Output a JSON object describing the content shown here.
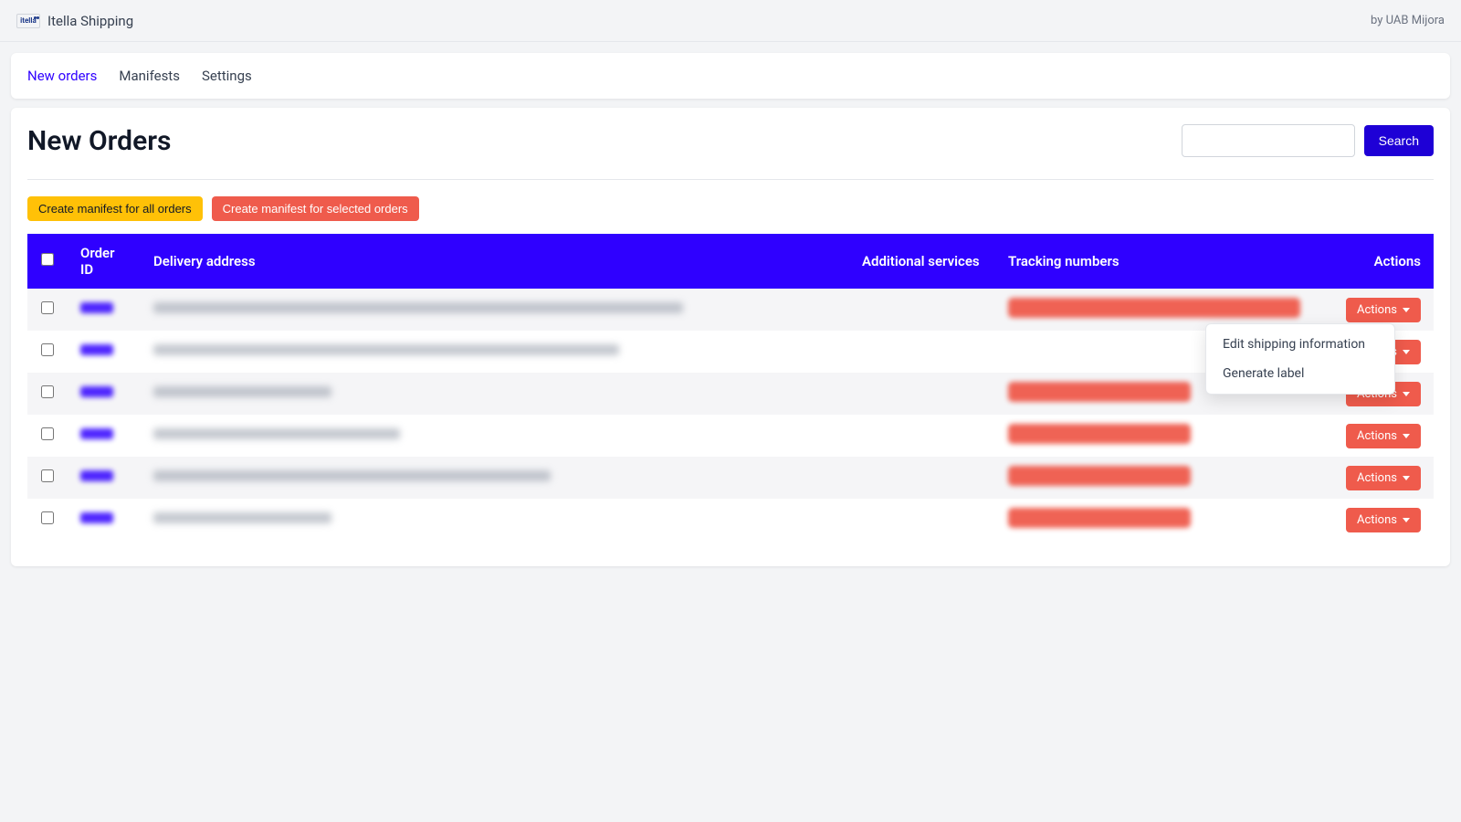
{
  "header": {
    "brand": "Itella Shipping",
    "logo_text": "itella",
    "byline": "by UAB Mijora"
  },
  "tabs": [
    {
      "label": "New orders",
      "active": true
    },
    {
      "label": "Manifests",
      "active": false
    },
    {
      "label": "Settings",
      "active": false
    }
  ],
  "page": {
    "title": "New Orders",
    "search_button": "Search"
  },
  "buttons": {
    "manifest_all": "Create manifest for all orders",
    "manifest_selected": "Create manifest for selected orders"
  },
  "columns": {
    "order_id": "Order ID",
    "delivery_address": "Delivery address",
    "additional_services": "Additional services",
    "tracking_numbers": "Tracking numbers",
    "actions": "Actions"
  },
  "row_actions_label": "Actions",
  "dropdown": {
    "edit": "Edit shipping information",
    "generate": "Generate label"
  },
  "rows": [
    {
      "addr_width": 580,
      "track_width": 320
    },
    {
      "addr_width": 510,
      "track_width": 0
    },
    {
      "addr_width": 195,
      "track_width": 200
    },
    {
      "addr_width": 270,
      "track_width": 200
    },
    {
      "addr_width": 435,
      "track_width": 200
    },
    {
      "addr_width": 195,
      "track_width": 200
    }
  ]
}
